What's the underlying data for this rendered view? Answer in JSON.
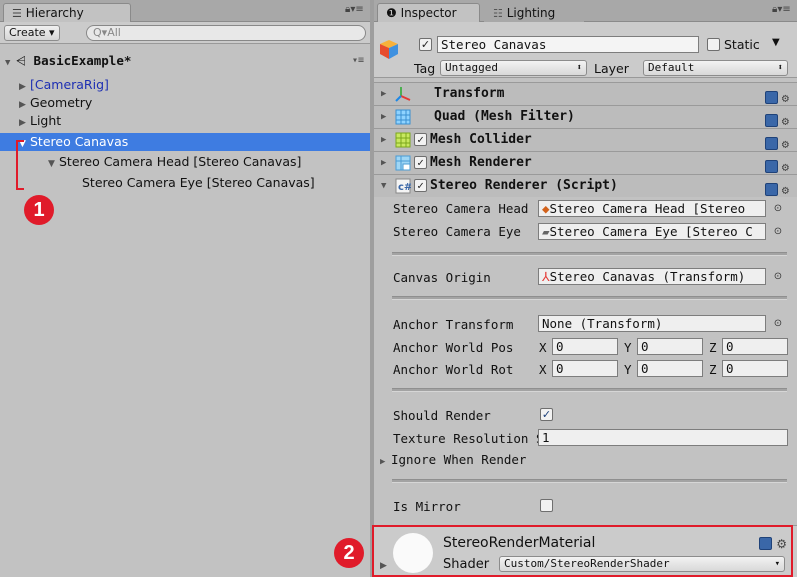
{
  "hierarchy": {
    "tab_label": "Hierarchy",
    "create_label": "Create",
    "search_placeholder": "All",
    "scene_name": "BasicExample*",
    "items": [
      {
        "label": "[CameraRig]"
      },
      {
        "label": "Geometry"
      },
      {
        "label": "Light"
      },
      {
        "label": "Stereo Canavas"
      },
      {
        "label": "Stereo Camera Head [Stereo Canavas]"
      },
      {
        "label": "Stereo Camera Eye [Stereo Canavas]"
      }
    ]
  },
  "inspector": {
    "tab_label": "Inspector",
    "lighting_tab_label": "Lighting",
    "object_name": "Stereo Canavas",
    "static_label": "Static",
    "tag_label": "Tag",
    "tag_value": "Untagged",
    "layer_label": "Layer",
    "layer_value": "Default",
    "components": [
      {
        "label": "Transform"
      },
      {
        "label": "Quad (Mesh Filter)"
      },
      {
        "label": "Mesh Collider"
      },
      {
        "label": "Mesh Renderer"
      },
      {
        "label": "Stereo Renderer (Script)"
      }
    ],
    "props": {
      "head_label": "Stereo Camera Head",
      "head_value": "Stereo Camera Head [Stereo",
      "eye_label": "Stereo Camera Eye",
      "eye_value": "Stereo Camera Eye [Stereo C",
      "canvas_origin_label": "Canvas Origin",
      "canvas_origin_value": "Stereo Canavas (Transform)",
      "anchor_transform_label": "Anchor Transform",
      "anchor_transform_value": "None (Transform)",
      "anchor_pos_label": "Anchor World Pos",
      "anchor_rot_label": "Anchor World Rot",
      "x_label": "X",
      "y_label": "Y",
      "z_label": "Z",
      "zero": "0",
      "should_render_label": "Should Render",
      "texture_res_label": "Texture Resolution S",
      "texture_res_value": "1",
      "ignore_label": "Ignore When Render",
      "mirror_label": "Is Mirror"
    },
    "material": {
      "name": "StereoRenderMaterial",
      "shader_label": "Shader",
      "shader_value": "Custom/StereoRenderShader"
    }
  },
  "annotations": {
    "badge1": "1",
    "badge2": "2"
  },
  "colors": {
    "selection": "#3e7ce1",
    "highlight_red": "#e01b2a",
    "prefab_blue": "#1d2fb3"
  }
}
